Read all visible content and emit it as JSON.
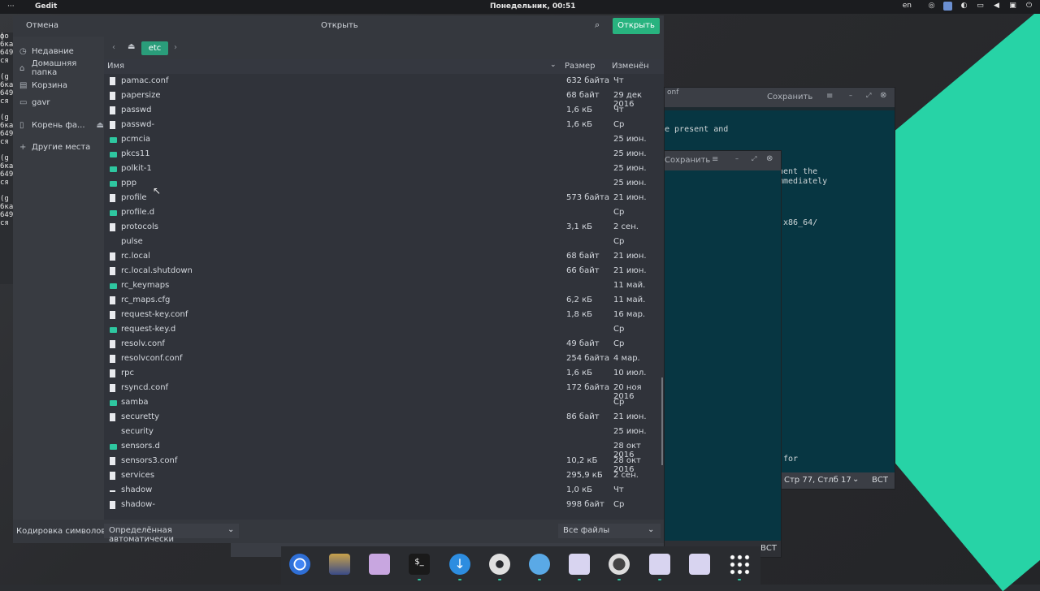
{
  "topbar": {
    "menu": "···",
    "app": "Gedit",
    "clock": "Понедельник, 00:51",
    "lang": "en"
  },
  "terminal_lines": [
    "фо",
    "6ка",
    "649",
    "ся",
    "",
    "(g",
    "6ка",
    "649",
    "ся",
    "",
    "(g",
    "6ка",
    "649",
    "ся",
    "",
    "(g",
    "6ка",
    "649",
    "ся",
    "",
    "(g",
    "6ка",
    "649",
    "ся"
  ],
  "gedit_back": {
    "tab_fragment": "onf",
    "save": "Сохранить",
    "text1": "e present and",
    "text2": "nent the",
    "text3": "mmediately",
    "text4": "x86_64/",
    "text5": "for",
    "status_pos": "Стр 77, Стлб 17",
    "status_mode": "ВСТ"
  },
  "gedit_mid": {
    "save": "Сохранить",
    "status_mode": "ВСТ"
  },
  "dialog": {
    "cancel": "Отмена",
    "title": "Открыть",
    "open": "Открыть",
    "path_current": "etc",
    "columns": {
      "name": "Имя",
      "size": "Размер",
      "modified": "Изменён"
    },
    "sidebar": [
      {
        "label": "Недавние",
        "icon": "clock-icon"
      },
      {
        "label": "Домашняя папка",
        "icon": "home-icon"
      },
      {
        "label": "Корзина",
        "icon": "trash-icon"
      },
      {
        "label": "gavr",
        "icon": "folder-icon"
      },
      {
        "label": "Корень фа...",
        "icon": "drive-icon"
      },
      {
        "label": "Другие места",
        "icon": "plus-icon"
      }
    ],
    "files": [
      {
        "name": "pamac.conf",
        "type": "file",
        "size": "632 байта",
        "modified": "Чт"
      },
      {
        "name": "papersize",
        "type": "file",
        "size": "68 байт",
        "modified": "29 дек 2016"
      },
      {
        "name": "passwd",
        "type": "file",
        "size": "1,6 кБ",
        "modified": "Чт"
      },
      {
        "name": "passwd-",
        "type": "file",
        "size": "1,6 кБ",
        "modified": "Ср"
      },
      {
        "name": "pcmcia",
        "type": "folder",
        "size": "",
        "modified": "25 июн."
      },
      {
        "name": "pkcs11",
        "type": "folder",
        "size": "",
        "modified": "25 июн."
      },
      {
        "name": "polkit-1",
        "type": "folder",
        "size": "",
        "modified": "25 июн."
      },
      {
        "name": "ppp",
        "type": "folder",
        "size": "",
        "modified": "25 июн."
      },
      {
        "name": "profile",
        "type": "file",
        "size": "573 байта",
        "modified": "21 июн."
      },
      {
        "name": "profile.d",
        "type": "folder",
        "size": "",
        "modified": "Ср"
      },
      {
        "name": "protocols",
        "type": "file",
        "size": "3,1 кБ",
        "modified": "2 сен."
      },
      {
        "name": "pulse",
        "type": "none",
        "size": "",
        "modified": "Ср"
      },
      {
        "name": "rc.local",
        "type": "file",
        "size": "68 байт",
        "modified": "21 июн."
      },
      {
        "name": "rc.local.shutdown",
        "type": "file",
        "size": "66 байт",
        "modified": "21 июн."
      },
      {
        "name": "rc_keymaps",
        "type": "folder",
        "size": "",
        "modified": "11 май."
      },
      {
        "name": "rc_maps.cfg",
        "type": "file",
        "size": "6,2 кБ",
        "modified": "11 май."
      },
      {
        "name": "request-key.conf",
        "type": "file",
        "size": "1,8 кБ",
        "modified": "16 мар."
      },
      {
        "name": "request-key.d",
        "type": "folder",
        "size": "",
        "modified": "Ср"
      },
      {
        "name": "resolv.conf",
        "type": "file",
        "size": "49 байт",
        "modified": "Ср"
      },
      {
        "name": "resolvconf.conf",
        "type": "file",
        "size": "254 байта",
        "modified": "4 мар."
      },
      {
        "name": "rpc",
        "type": "file",
        "size": "1,6 кБ",
        "modified": "10 июл."
      },
      {
        "name": "rsyncd.conf",
        "type": "file",
        "size": "172 байта",
        "modified": "20 ноя 2016"
      },
      {
        "name": "samba",
        "type": "folder",
        "size": "",
        "modified": "Ср"
      },
      {
        "name": "securetty",
        "type": "file",
        "size": "86 байт",
        "modified": "21 июн."
      },
      {
        "name": "security",
        "type": "none",
        "size": "",
        "modified": "25 июн."
      },
      {
        "name": "sensors.d",
        "type": "folder",
        "size": "",
        "modified": "28 окт 2016"
      },
      {
        "name": "sensors3.conf",
        "type": "file",
        "size": "10,2 кБ",
        "modified": "28 окт 2016"
      },
      {
        "name": "services",
        "type": "file",
        "size": "295,9 кБ",
        "modified": "2 сен."
      },
      {
        "name": "shadow",
        "type": "dash",
        "size": "1,0 кБ",
        "modified": "Чт"
      },
      {
        "name": "shadow-",
        "type": "file",
        "size": "998 байт",
        "modified": "Ср"
      }
    ],
    "encoding_label": "Кодировка символов:",
    "encoding_value": "Определённая автоматически",
    "filter_value": "Все файлы"
  },
  "dock": [
    "chrome-icon",
    "league-icon",
    "files-icon",
    "terminal-icon",
    "download-icon",
    "settings-icon",
    "browser-icon",
    "text-editor-icon",
    "obs-icon",
    "text-editor-icon",
    "text-editor-icon",
    "apps-grid-icon"
  ],
  "colors": {
    "accent": "#28b37f",
    "folder": "#2ec7a0",
    "editor_bg": "#073642"
  }
}
